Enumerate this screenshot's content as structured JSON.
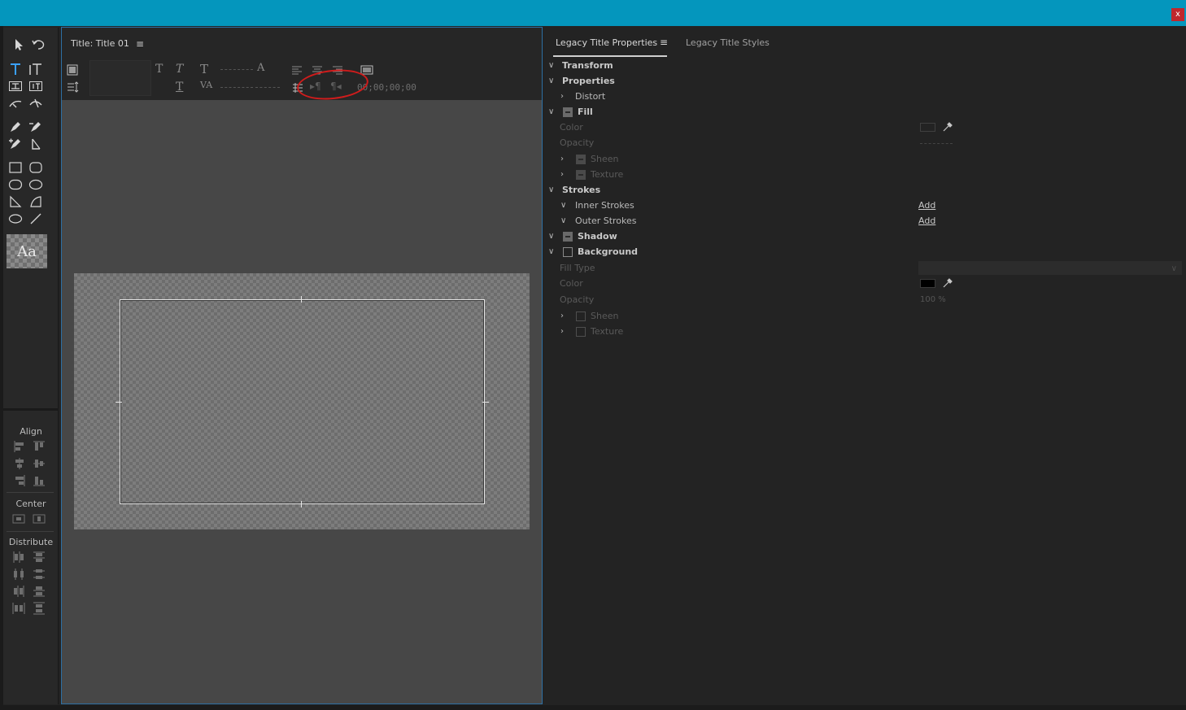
{
  "window": {
    "close_label": "x"
  },
  "tools": {
    "style_swatch_text": "Aa",
    "align_label": "Align",
    "center_label": "Center",
    "distribute_label": "Distribute"
  },
  "title_panel": {
    "tab_label": "Title: Title 01",
    "menu_icon": "hamburger-icon",
    "timecode": "00;00;00;00"
  },
  "properties": {
    "tab_active": "Legacy Title Properties",
    "tab_inactive": "Legacy Title Styles",
    "menu_icon": "hamburger-icon",
    "rows": {
      "transform": "Transform",
      "properties": "Properties",
      "distort": "Distort",
      "fill": "Fill",
      "fill_color": "Color",
      "fill_opacity": "Opacity",
      "fill_sheen": "Sheen",
      "fill_texture": "Texture",
      "strokes": "Strokes",
      "inner_strokes": "Inner Strokes",
      "outer_strokes": "Outer Strokes",
      "add_inner": "Add",
      "add_outer": "Add",
      "shadow": "Shadow",
      "background": "Background",
      "fill_type": "Fill Type",
      "bg_color": "Color",
      "bg_opacity": "Opacity",
      "bg_opacity_value": "100 %",
      "bg_sheen": "Sheen",
      "bg_texture": "Texture"
    },
    "bg_color_value": "#000000"
  },
  "colors": {
    "titlebar": "#0496bd",
    "close": "#c0272d",
    "panel_focus_border": "#2d6fa3",
    "annotation": "#cf1c1c"
  }
}
